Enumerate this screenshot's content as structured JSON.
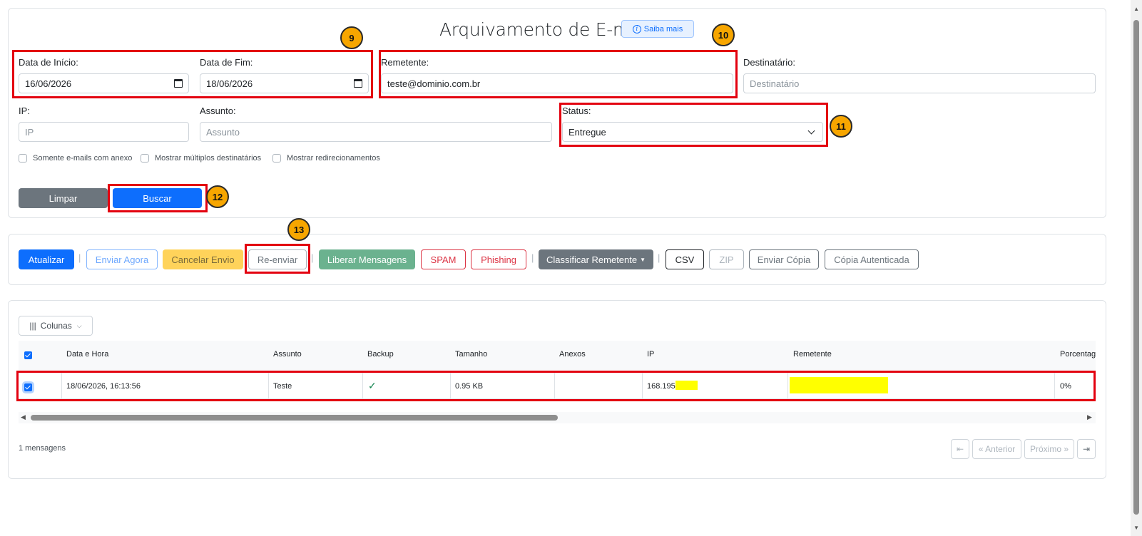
{
  "title": "Arquivamento de E-mails",
  "saiba_mais": "Saiba mais",
  "filters": {
    "data_inicio_label": "Data de Início:",
    "data_inicio_value": "16/06/2026",
    "data_fim_label": "Data de Fim:",
    "data_fim_value": "18/06/2026",
    "remetente_label": "Remetente:",
    "remetente_value": "teste@dominio.com.br",
    "destinatario_label": "Destinatário:",
    "destinatario_placeholder": "Destinatário",
    "ip_label": "IP:",
    "ip_placeholder": "IP",
    "assunto_label": "Assunto:",
    "assunto_placeholder": "Assunto",
    "status_label": "Status:",
    "status_value": "Entregue",
    "checkboxes": [
      "Somente e-mails com anexo",
      "Mostrar múltiplos destinatários",
      "Mostrar redirecionamentos"
    ],
    "limpar": "Limpar",
    "buscar": "Buscar"
  },
  "actions": {
    "atualizar": "Atualizar",
    "enviar_agora": "Enviar Agora",
    "cancelar_envio": "Cancelar Envio",
    "reenviar": "Re-enviar",
    "liberar": "Liberar Mensagens",
    "spam": "SPAM",
    "phishing": "Phishing",
    "classificar": "Classificar Remetente",
    "csv": "CSV",
    "zip": "ZIP",
    "enviar_copia": "Enviar Cópia",
    "copia_autenticada": "Cópia Autenticada",
    "separator": "|"
  },
  "table": {
    "colunas_label": "Colunas",
    "headers": [
      "Data e Hora",
      "Assunto",
      "Backup",
      "Tamanho",
      "Anexos",
      "IP",
      "Remetente",
      "Porcentage"
    ],
    "row": {
      "data_hora": "18/06/2026, 16:13:56",
      "assunto": "Teste",
      "tamanho": "0.95 KB",
      "ip": "168.195.",
      "porcentagem": "0%"
    },
    "count_text": "1 mensagens",
    "pagination": {
      "first": "⇤",
      "prev": "« Anterior",
      "next": "Próximo »",
      "last": "⇥"
    }
  },
  "badges": [
    "9",
    "10",
    "11",
    "12",
    "13"
  ],
  "colors": {
    "primary": "#0d6efd",
    "secondary": "#6c757d",
    "warning": "#ffca2c",
    "success": "#6bb28f",
    "danger": "#dc3545",
    "annotation_red": "#e3000f",
    "annotation_badge": "#f7a600",
    "redaction": "#ffff00"
  }
}
